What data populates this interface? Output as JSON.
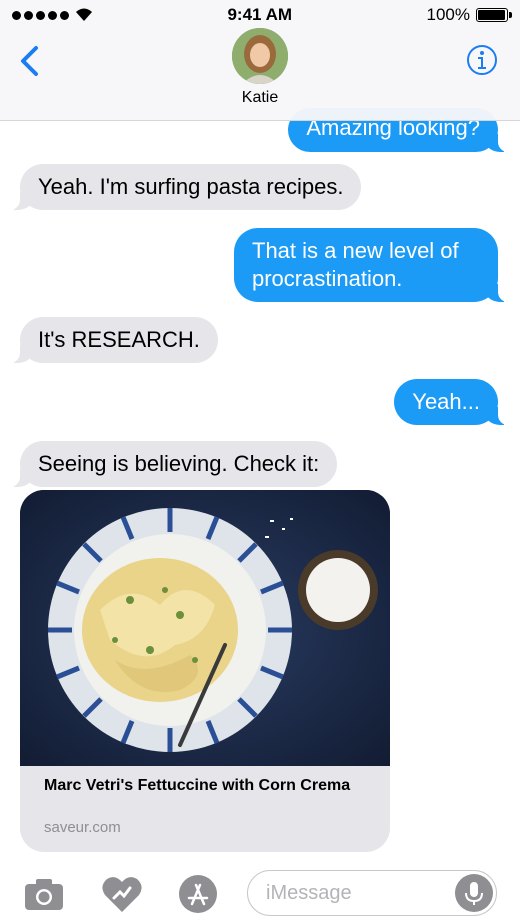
{
  "status_bar": {
    "time": "9:41 AM",
    "battery_text": "100%",
    "battery_level": 1.0
  },
  "header": {
    "contact_name": "Katie",
    "back_icon": "chevron-left-icon",
    "info_icon": "info-icon"
  },
  "messages": [
    {
      "direction": "outgoing",
      "text": "Amazing looking?"
    },
    {
      "direction": "incoming",
      "text": "Yeah. I'm surfing pasta recipes."
    },
    {
      "direction": "outgoing",
      "text": "That is a new level of procrastination."
    },
    {
      "direction": "incoming",
      "text": "It's RESEARCH."
    },
    {
      "direction": "outgoing",
      "text": "Yeah..."
    },
    {
      "direction": "incoming",
      "text": "Seeing is believing. Check it:"
    }
  ],
  "link_preview": {
    "title": "Marc Vetri's Fettuccine with Corn Crema",
    "domain": "saveur.com"
  },
  "input_bar": {
    "placeholder": "iMessage",
    "icons": [
      "camera-icon",
      "digital-touch-icon",
      "app-store-icon",
      "microphone-icon"
    ]
  },
  "colors": {
    "accent": "#1c9bf6",
    "incoming_bubble": "#e5e5ea",
    "nav_icon": "#1a7ef2"
  }
}
